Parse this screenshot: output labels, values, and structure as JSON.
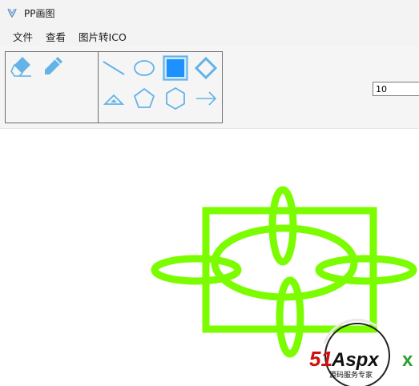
{
  "window": {
    "title": "PP画图"
  },
  "menu": {
    "items": [
      "文件",
      "查看",
      "图片转ICO"
    ]
  },
  "toolbar": {
    "edit_tools": [
      "eraser-icon",
      "pencil-icon"
    ],
    "shape_tools": [
      "line-icon",
      "ellipse-icon",
      "rectangle-icon",
      "diamond-icon",
      "triangle-icon",
      "pentagon-icon",
      "hexagon-icon",
      "arrow-icon"
    ],
    "selected_tool": "rectangle-icon",
    "pen_width": "10"
  },
  "colors": {
    "stroke": "#7cfc00",
    "tool_icon": "#63b3e6",
    "selected_fill": "#1e90ff"
  },
  "watermark": {
    "brand": "51Aspx",
    "tagline": "源码服务专家"
  }
}
